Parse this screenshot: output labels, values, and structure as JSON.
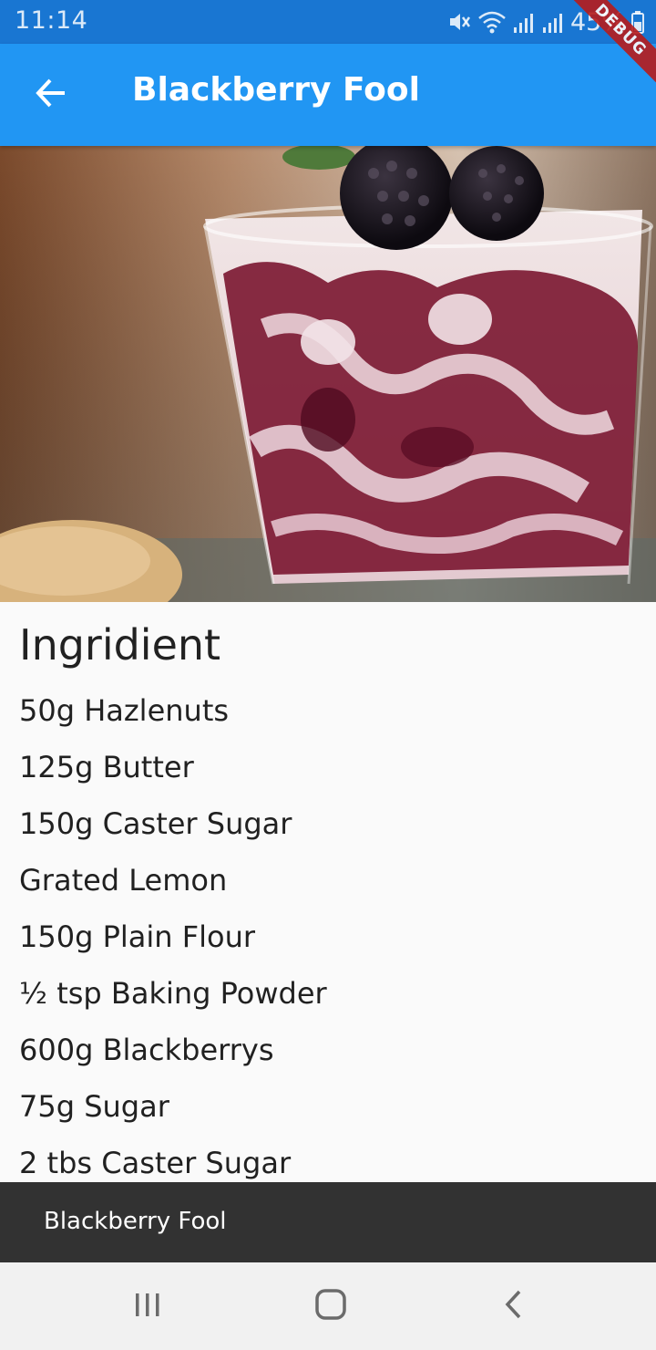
{
  "status_bar": {
    "time": "11:14",
    "battery": "45%",
    "icons": [
      "mute-icon",
      "wifi-icon",
      "signal-icon",
      "signal-icon",
      "battery-icon"
    ]
  },
  "debug_banner": "DEBUG",
  "app_bar": {
    "title": "Blackberry Fool",
    "back_icon": "arrow-back-icon",
    "background": "#2196f3"
  },
  "ingredients": {
    "heading": "Ingridient",
    "items": [
      "50g Hazlenuts",
      "125g Butter",
      "150g Caster Sugar",
      "Grated Lemon",
      "150g Plain Flour",
      "½ tsp Baking Powder",
      "600g Blackberrys",
      "75g Sugar",
      "2 tbs Caster Sugar"
    ]
  },
  "snackbar": {
    "text": "Blackberry Fool"
  },
  "nav_bar": {
    "icons": [
      "recent-apps-icon",
      "home-icon",
      "back-icon"
    ]
  }
}
